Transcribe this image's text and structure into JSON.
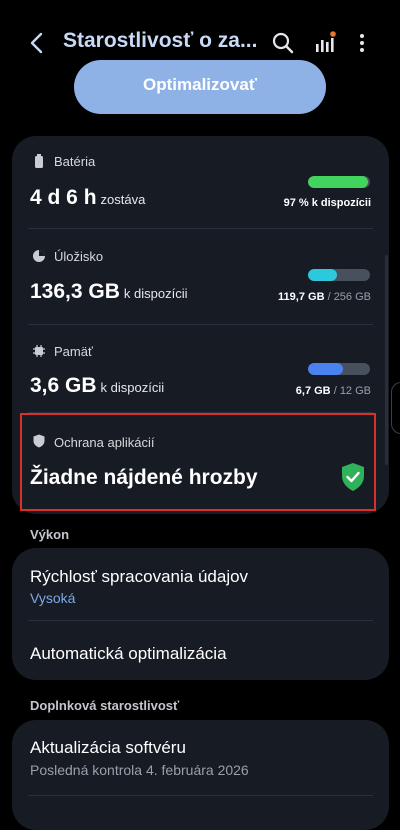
{
  "header": {
    "title": "Starostlivosť o za...",
    "icons": [
      "back-arrow-icon",
      "search-icon",
      "bar-chart-icon",
      "more-vert-icon"
    ],
    "accent": "#e8772e"
  },
  "optimize_button": {
    "label": "Optimalizovať",
    "color": "#8fb2e6"
  },
  "battery": {
    "label": "Batéria",
    "value": "4 d 6 h",
    "value_suffix": "zostáva",
    "caption": "97 % k dispozícii",
    "level": 0.97,
    "color": "#42d45c"
  },
  "storage": {
    "label": "Úložisko",
    "value": "136,3 GB",
    "value_suffix": "k dispozícii",
    "used": "119,7 GB",
    "total": "/ 256 GB",
    "level": 0.47,
    "color": "#2cc8dc"
  },
  "memory": {
    "label": "Pamäť",
    "value": "3,6 GB",
    "value_suffix": "k dispozícii",
    "used": "6,7 GB",
    "total": "/ 12 GB",
    "level": 0.56,
    "color": "#4a82f0"
  },
  "app_protection": {
    "label": "Ochrana aplikácií",
    "status": "Žiadne nájdené hrozby",
    "status_color": "#2fb25a",
    "highlight_color": "#d9302c"
  },
  "performance": {
    "group_label": "Výkon",
    "processing_speed": {
      "title": "Rýchlosť spracovania údajov",
      "value": "Vysoká",
      "value_color": "#7fa8e8"
    },
    "auto_optimization": {
      "title": "Automatická optimalizácia"
    }
  },
  "additional": {
    "group_label": "Doplnková starostlivosť",
    "software_update": {
      "title": "Aktualizácia softvéru",
      "subtitle": "Posledná kontrola 4. februára 2026"
    }
  }
}
